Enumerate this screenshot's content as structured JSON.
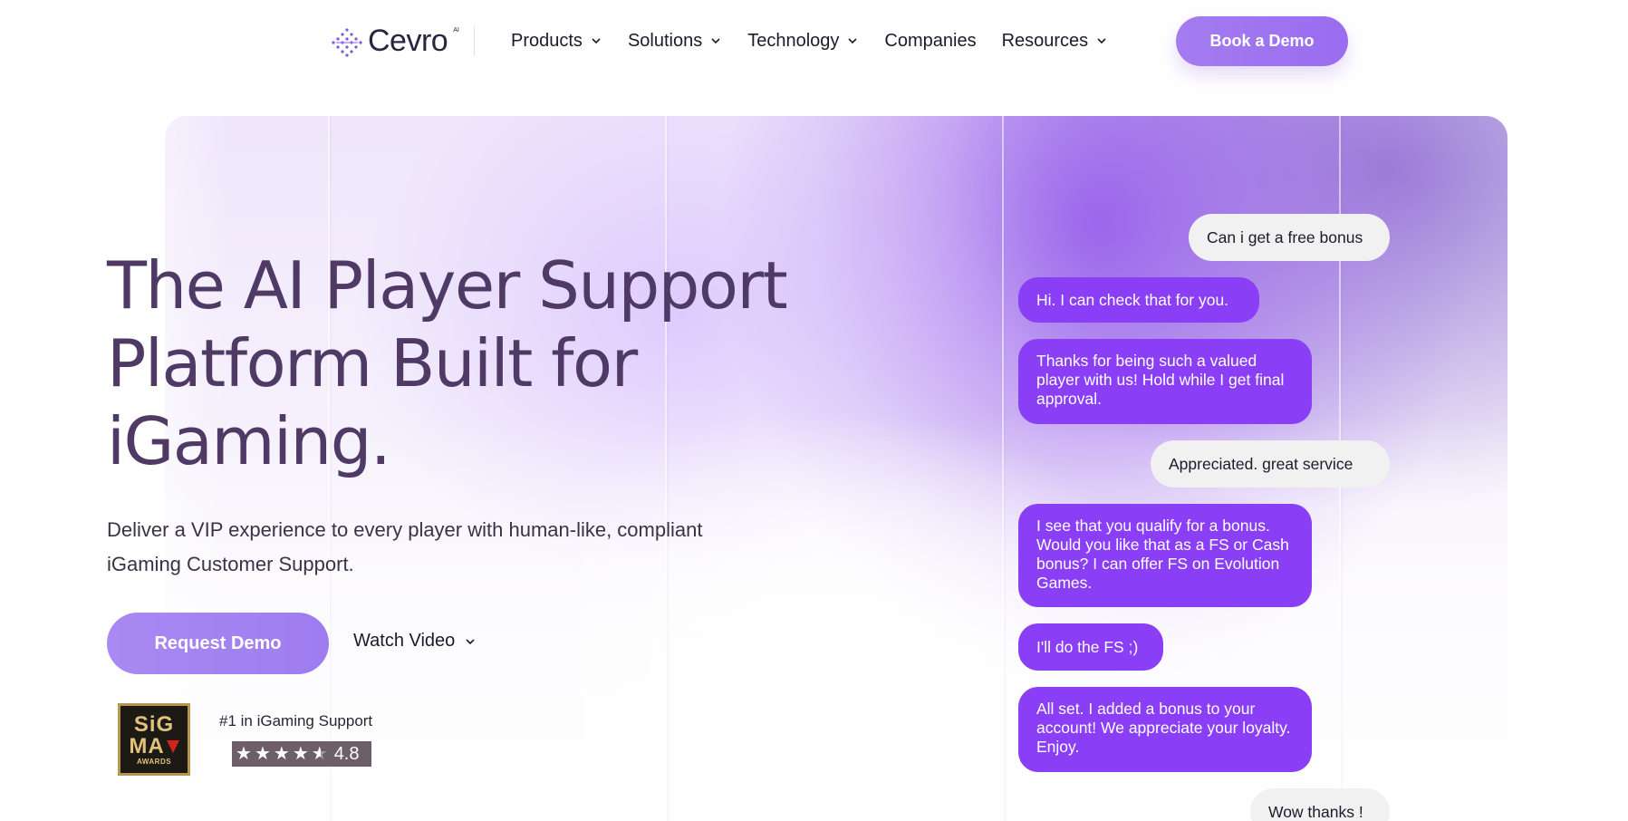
{
  "nav": {
    "logo_text": "Cevro",
    "logo_tm": "AI",
    "menu": [
      {
        "label": "Products",
        "has_dropdown": true
      },
      {
        "label": "Solutions",
        "has_dropdown": true
      },
      {
        "label": "Technology",
        "has_dropdown": true
      },
      {
        "label": "Companies",
        "has_dropdown": false
      },
      {
        "label": "Resources",
        "has_dropdown": true
      }
    ],
    "cta_label": "Book a Demo"
  },
  "hero": {
    "headline_line1": "The AI Player Support",
    "headline_line2": "Platform Built for",
    "headline_line3": "iGaming.",
    "subtext_line1": "Deliver a VIP experience to every player with human-like, compliant",
    "subtext_line2": "iGaming Customer Support.",
    "primary_cta": "Request Demo",
    "secondary_cta": "Watch Video",
    "award": {
      "line1": "SiG",
      "line2": "MA",
      "line3": "AWARDS",
      "rank_text": "#1 in iGaming Support",
      "rating_value": "4.8",
      "rating_stars": 4.5
    }
  },
  "chat": [
    {
      "role": "user",
      "text": "Can i get a free bonus"
    },
    {
      "role": "bot",
      "text": "Hi. I can check that for you."
    },
    {
      "role": "bot",
      "text": "Thanks for being such a valued player with us! Hold while I get final approval."
    },
    {
      "role": "user",
      "text": "Appreciated. great service"
    },
    {
      "role": "bot",
      "text": "I see that you qualify for a bonus. Would you like that as a FS or Cash bonus? I can offer FS on Evolution Games."
    },
    {
      "role": "bot",
      "text": "I'll do the FS ;)"
    },
    {
      "role": "bot",
      "text": "All set. I added a bonus to your account! We appreciate your loyalty. Enjoy."
    },
    {
      "role": "user",
      "text": "Wow thanks !"
    }
  ],
  "colors": {
    "brand_purple": "#8a3ef5",
    "cta_purple": "#a57cf0",
    "headline": "#4f3a66",
    "user_bubble": "#f1f1f1"
  }
}
